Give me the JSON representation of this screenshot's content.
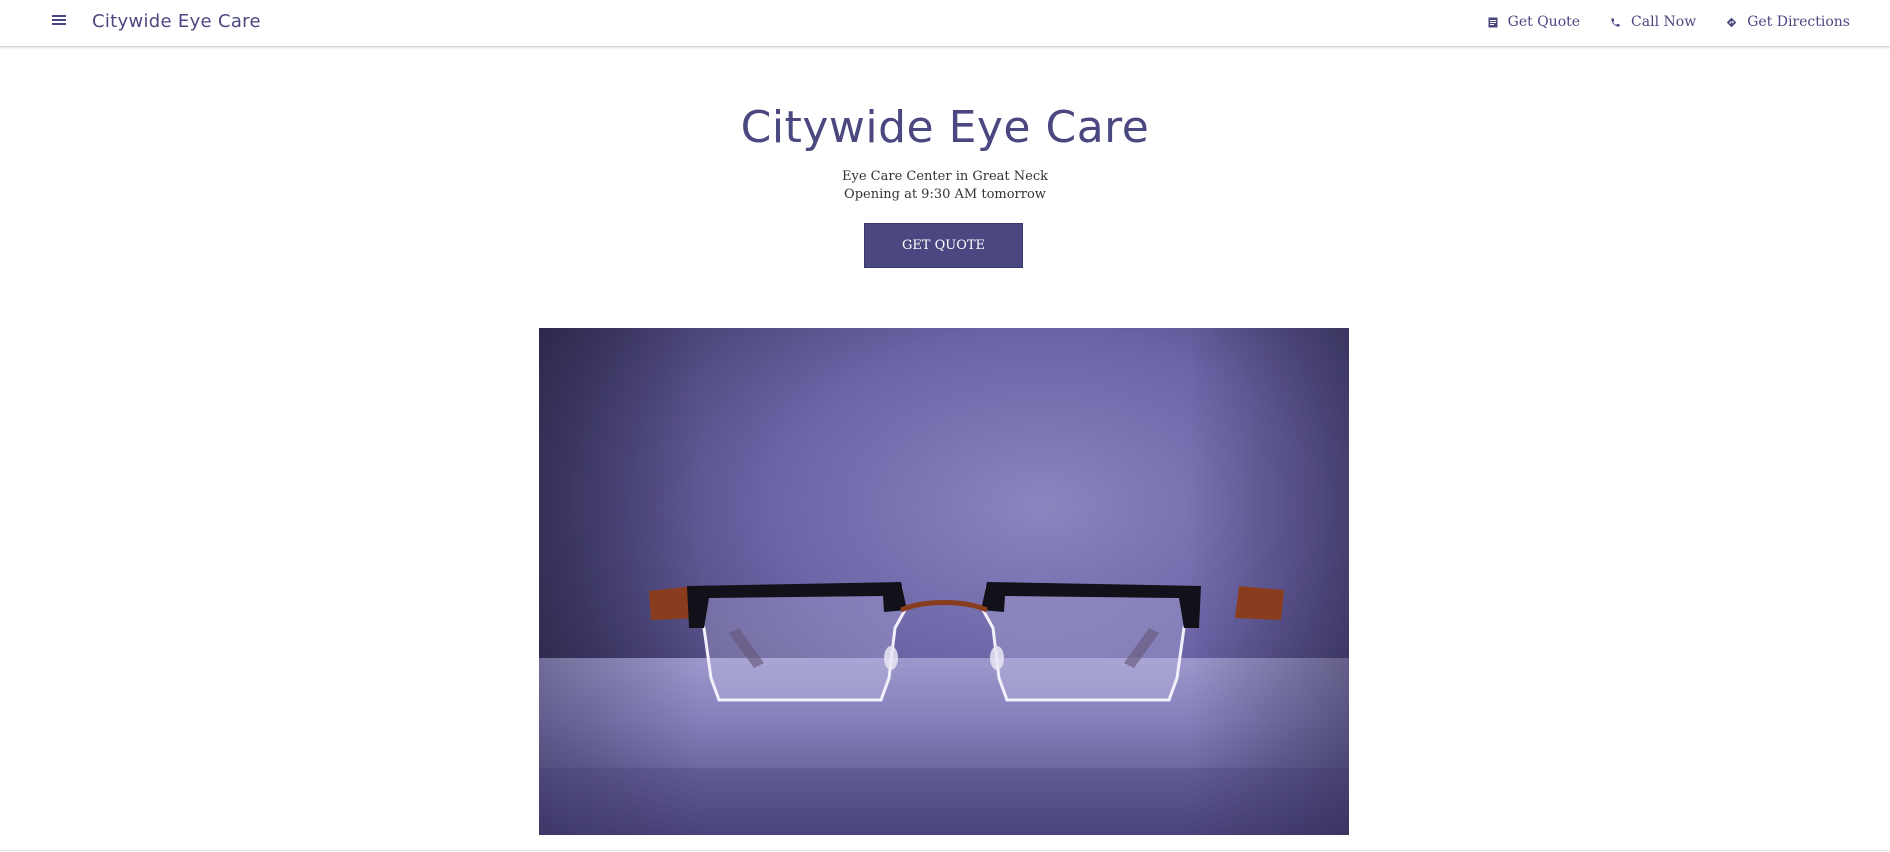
{
  "header": {
    "brand": "Citywide Eye Care",
    "menu_icon": "menu-icon",
    "nav": [
      {
        "label": "Get Quote",
        "icon": "quote-icon"
      },
      {
        "label": "Call Now",
        "icon": "phone-icon"
      },
      {
        "label": "Get Directions",
        "icon": "directions-icon"
      }
    ]
  },
  "hero": {
    "title": "Citywide Eye Care",
    "subtitle": "Eye Care Center in Great Neck",
    "hours": "Opening at 9:30 AM tomorrow",
    "cta_label": "GET QUOTE",
    "image_subject": "eyeglasses on purple fabric"
  },
  "colors": {
    "brand": "#4b4780",
    "text": "#333333",
    "background": "#ffffff"
  }
}
